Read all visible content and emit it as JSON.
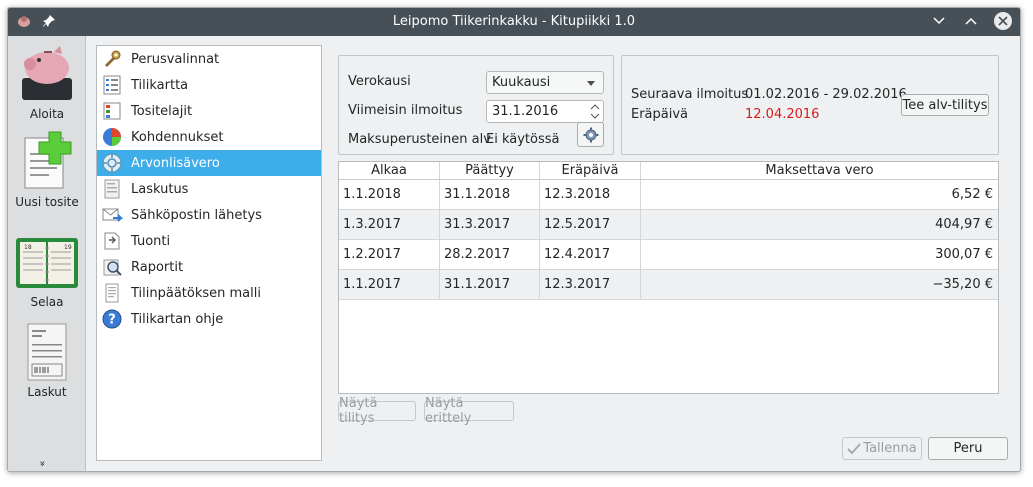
{
  "window": {
    "title": "Leipomo Tiikerinkakku - Kitupiikki 1.0"
  },
  "leftbar": {
    "items": [
      {
        "label": "Aloita",
        "icon": "piggy-bank-icon"
      },
      {
        "label": "Uusi tosite",
        "icon": "new-document-icon"
      },
      {
        "label": "Selaa",
        "icon": "book-icon"
      },
      {
        "label": "Laskut",
        "icon": "invoice-icon"
      }
    ],
    "expand": "»"
  },
  "nav": {
    "items": [
      {
        "label": "Perusvalinnat",
        "icon": "tools-icon"
      },
      {
        "label": "Tilikartta",
        "icon": "chart-of-accounts-icon"
      },
      {
        "label": "Tositelajit",
        "icon": "document-types-icon"
      },
      {
        "label": "Kohdennukset",
        "icon": "pie-chart-icon"
      },
      {
        "label": "Arvonlisävero",
        "icon": "vat-icon"
      },
      {
        "label": "Laskutus",
        "icon": "invoicing-icon"
      },
      {
        "label": "Sähköpostin lähetys",
        "icon": "email-send-icon"
      },
      {
        "label": "Tuonti",
        "icon": "import-icon"
      },
      {
        "label": "Raportit",
        "icon": "reports-icon"
      },
      {
        "label": "Tilinpäätöksen malli",
        "icon": "financial-statement-icon"
      },
      {
        "label": "Tilikartan ohje",
        "icon": "help-icon"
      }
    ],
    "selected_index": 4
  },
  "settings": {
    "verokausi_label": "Verokausi",
    "verokausi_value": "Kuukausi",
    "viimeisin_label": "Viimeisin ilmoitus",
    "viimeisin_value": "31.1.2016",
    "maksuperuste_label": "Maksuperusteinen alv",
    "maksuperuste_value": "Ei käytössä"
  },
  "next": {
    "seuraava_label": "Seuraava ilmoitus",
    "seuraava_value": "01.02.2016 - 29.02.2016",
    "erapaiva_label": "Eräpäivä",
    "erapaiva_value": "12.04.2016",
    "button": "Tee alv-tilitys"
  },
  "table": {
    "headers": [
      "Alkaa",
      "Päättyy",
      "Eräpäivä",
      "Maksettava vero"
    ],
    "rows": [
      [
        "1.1.2018",
        "31.1.2018",
        "12.3.2018",
        "6,52 €"
      ],
      [
        "1.3.2017",
        "31.3.2017",
        "12.5.2017",
        "404,97 €"
      ],
      [
        "1.2.2017",
        "28.2.2017",
        "12.4.2017",
        "300,07 €"
      ],
      [
        "1.1.2017",
        "31.1.2017",
        "12.3.2017",
        "−35,20 €"
      ]
    ]
  },
  "buttons": {
    "nayta_tilitys": "Näytä tilitys",
    "nayta_erittely": "Näytä erittely",
    "tallenna": "Tallenna",
    "peru": "Peru"
  },
  "colors": {
    "accent": "#3daee9",
    "titlebar": "#475057",
    "due_date": "#da1a1a"
  }
}
